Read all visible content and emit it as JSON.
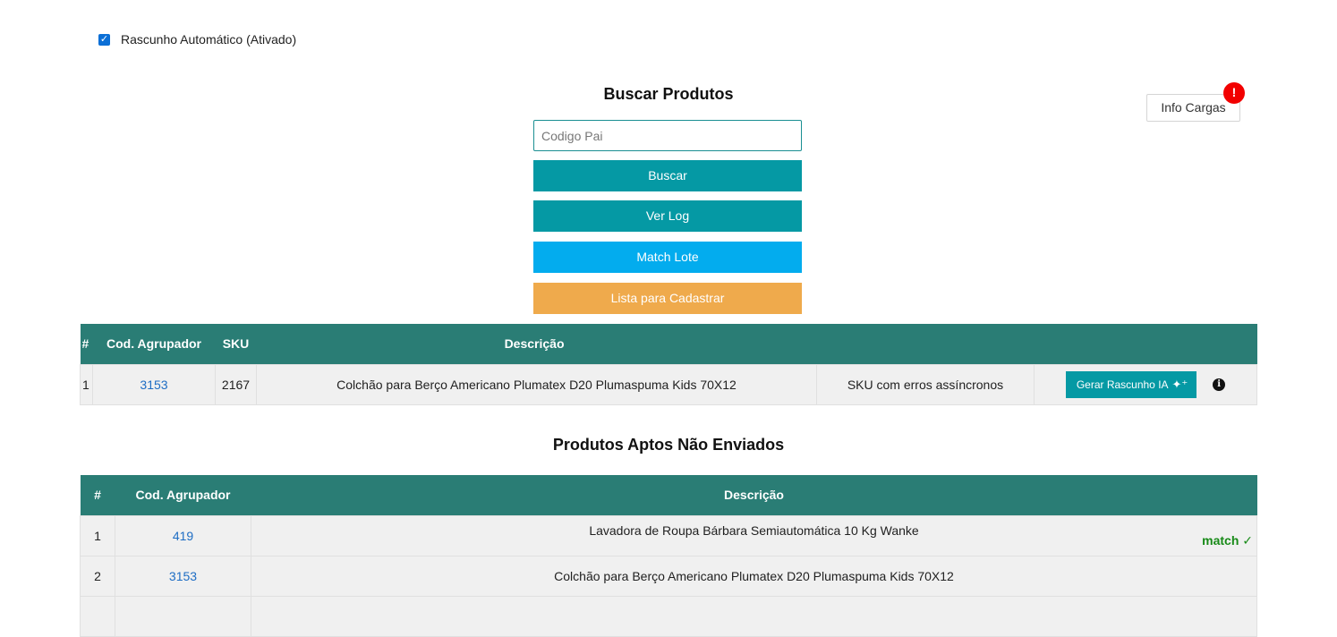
{
  "auto_draft": {
    "label": "Rascunho Automático (Ativado)",
    "checked": true
  },
  "search": {
    "title": "Buscar Produtos",
    "placeholder": "Codigo Pai",
    "buttons": {
      "buscar": "Buscar",
      "ver_log": "Ver Log",
      "match_lote": "Match Lote",
      "lista": "Lista para Cadastrar"
    }
  },
  "info_cargas": {
    "label": "Info Cargas",
    "badge": "!"
  },
  "results_table": {
    "headers": [
      "#",
      "Cod. Agrupador",
      "SKU",
      "Descrição"
    ],
    "rows": [
      {
        "num": "1",
        "cod": "3153",
        "sku": "2167",
        "desc": "Colchão para Berço Americano Plumatex D20 Plumaspuma Kids 70X12",
        "status": "SKU com erros assíncronos",
        "action": "Gerar Rascunho IA"
      }
    ]
  },
  "apt_table": {
    "title": "Produtos Aptos Não Enviados",
    "headers": [
      "#",
      "Cod. Agrupador",
      "Descrição"
    ],
    "rows": [
      {
        "num": "1",
        "cod": "419",
        "desc": "Lavadora de Roupa Bárbara Semiautomática 10 Kg Wanke",
        "match": "match ✓"
      },
      {
        "num": "2",
        "cod": "3153",
        "desc": "Colchão para Berço Americano Plumatex D20 Plumaspuma Kids 70X12"
      }
    ]
  },
  "colors": {
    "primary": "#0599a4",
    "header": "#2a7d75",
    "match_btn": "#03acee",
    "list_btn": "#efaa4c",
    "alert": "#f20000",
    "match_text": "#178a17"
  }
}
